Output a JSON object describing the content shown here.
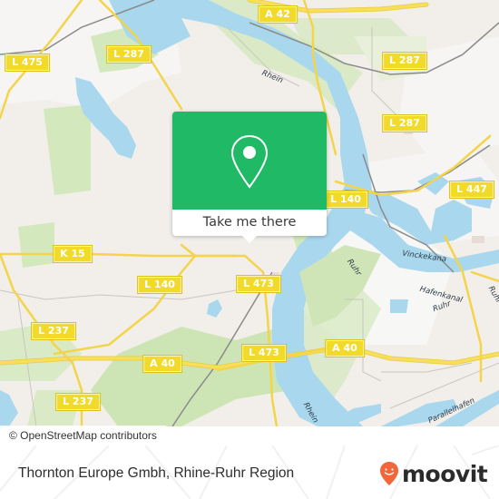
{
  "map": {
    "road_labels": [
      {
        "id": "a42",
        "text": "A 42"
      },
      {
        "id": "l475",
        "text": "L 475"
      },
      {
        "id": "l287a",
        "text": "L 287"
      },
      {
        "id": "l287b",
        "text": "L 287"
      },
      {
        "id": "l287c",
        "text": "L 287"
      },
      {
        "id": "l447",
        "text": "L 447"
      },
      {
        "id": "l140a",
        "text": "L 140"
      },
      {
        "id": "k15",
        "text": "K 15"
      },
      {
        "id": "l140b",
        "text": "L 140"
      },
      {
        "id": "l473a",
        "text": "L 473"
      },
      {
        "id": "l237a",
        "text": "L 237"
      },
      {
        "id": "a40a",
        "text": "A 40"
      },
      {
        "id": "l473b",
        "text": "L 473"
      },
      {
        "id": "a40b",
        "text": "A 40"
      },
      {
        "id": "l237b",
        "text": "L 237"
      }
    ],
    "water_labels": {
      "rhein_north": "Rhein",
      "ruhr_1": "Ruhr",
      "vinckekanal": "Vinckekana",
      "hafenkanal": "Hafenkanal",
      "ruhr_2": "Ruhr",
      "ruhr_3": "Ruhr",
      "rhein_south": "Rhein",
      "parallelhafen": "Parallelhafen"
    },
    "colors": {
      "water": "#a9d8ee",
      "park": "#d3e8bd",
      "road": "#f5dc55",
      "land": "#f2efea"
    }
  },
  "popup": {
    "icon": "map-pin-icon",
    "cta_label": "Take me there",
    "color": "#20ba66"
  },
  "attribution": "© OpenStreetMap contributors",
  "footer": {
    "place_name": "Thornton Europe Gmbh, Rhine-Ruhr Region",
    "brand": "moovit",
    "brand_color": "#f2663a"
  }
}
